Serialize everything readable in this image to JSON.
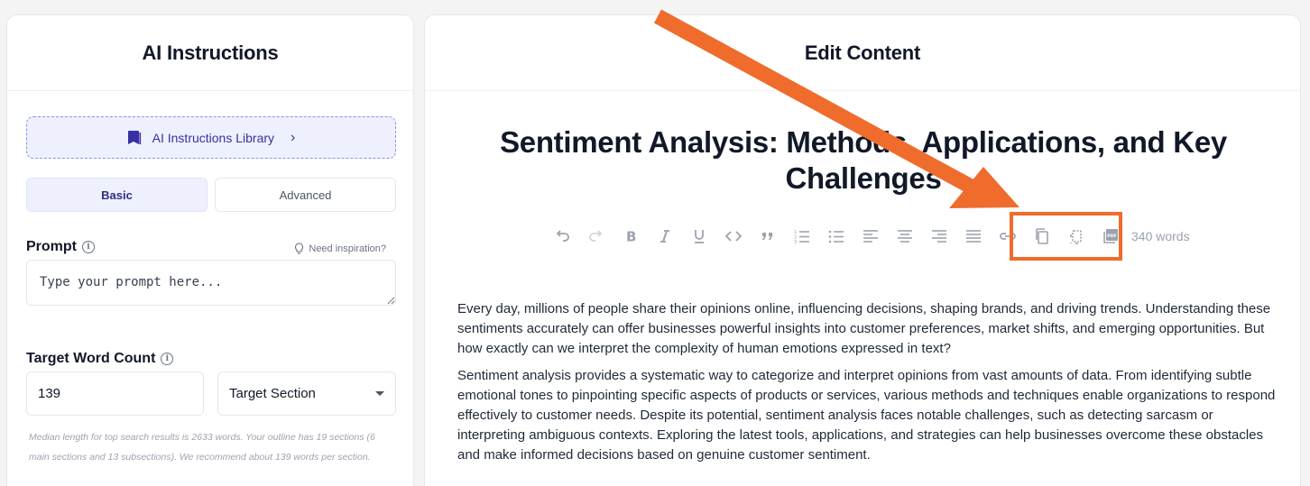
{
  "left_panel": {
    "title": "AI Instructions",
    "library_button": "AI Instructions Library",
    "tabs": {
      "basic": "Basic",
      "advanced": "Advanced"
    },
    "prompt": {
      "label": "Prompt",
      "inspiration": "Need inspiration?",
      "placeholder": "Type your prompt here..."
    },
    "target_word_count": {
      "label": "Target Word Count",
      "value": "139",
      "section_select": "Target Section",
      "hint": "Median length for top search results is 2633 words. Your outline has 19 sections (6 main sections and 13 subsections). We recommend about 139 words per section."
    }
  },
  "right_panel": {
    "title": "Edit Content",
    "document_title": "Sentiment Analysis: Methods, Applications, and Key Challenges",
    "word_count": "340 words",
    "toolbar": [
      "undo-icon",
      "redo-icon",
      "bold-icon",
      "italic-icon",
      "underline-icon",
      "code-icon",
      "quote-icon",
      "ordered-list-icon",
      "bullet-list-icon",
      "align-left-icon",
      "align-center-icon",
      "align-right-icon",
      "align-justify-icon",
      "link-icon",
      "copy-icon",
      "copy-html-icon",
      "pdf-export-icon"
    ],
    "paragraphs": [
      "Every day, millions of people share their opinions online, influencing decisions, shaping brands, and driving trends. Understanding these sentiments accurately can offer businesses powerful insights into customer preferences, market shifts, and emerging opportunities. But how exactly can we interpret the complexity of human emotions expressed in text?",
      "Sentiment analysis provides a systematic way to categorize and interpret opinions from vast amounts of data. From identifying subtle emotional tones to pinpointing specific aspects of products or services, various methods and techniques enable organizations to respond effectively to customer needs. Despite its potential, sentiment analysis faces notable challenges, such as detecting sarcasm or interpreting ambiguous contexts. Exploring the latest tools, applications, and strategies can help businesses overcome these obstacles and make informed decisions based on genuine customer sentiment."
    ]
  },
  "colors": {
    "accent": "#3730a3",
    "annotation": "#ef6c2d",
    "toolbar_icon": "#9ca3af"
  }
}
